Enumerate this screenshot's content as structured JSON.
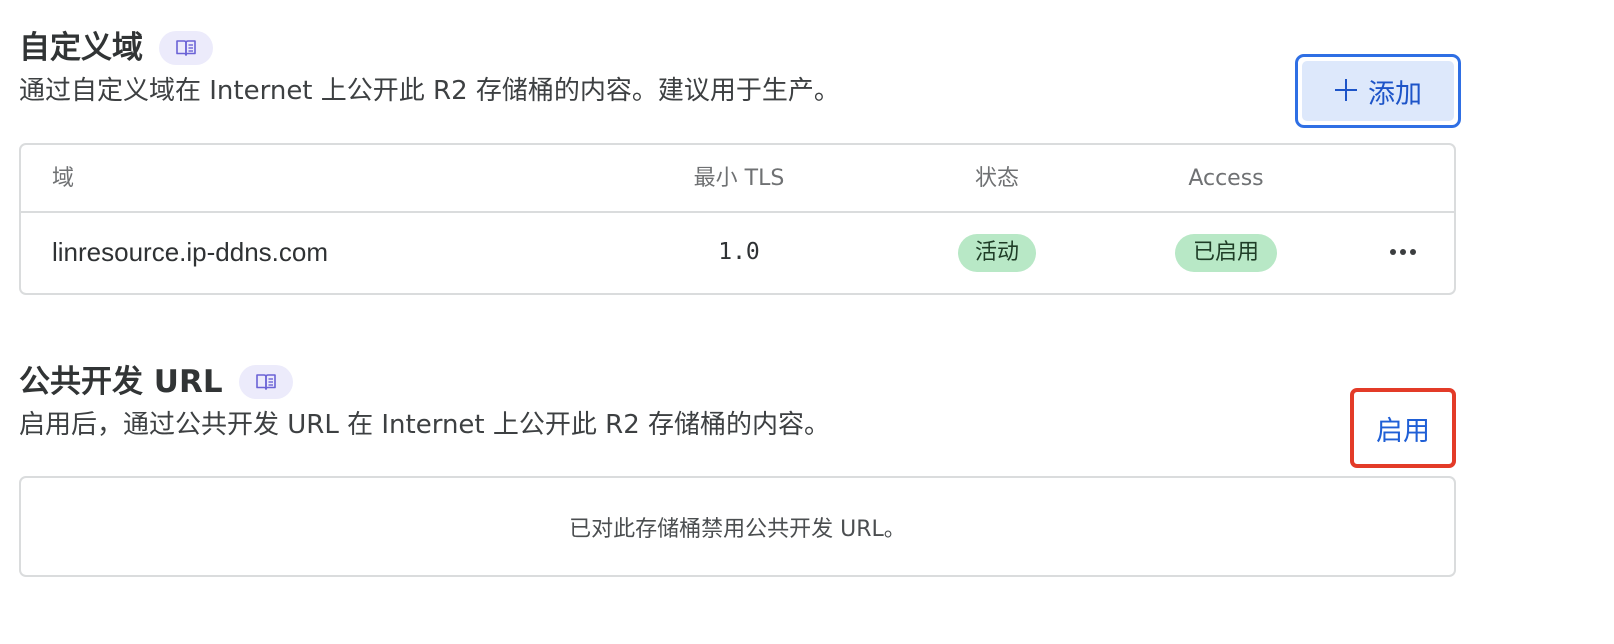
{
  "custom_domains": {
    "title": "自定义域",
    "doc_icon": "book-icon",
    "description": "通过自定义域在 Internet 上公开此 R2 存储桶的内容。建议用于生产。",
    "add_button": {
      "icon": "plus-icon",
      "label": "添加"
    },
    "table": {
      "columns": [
        "域",
        "最小 TLS",
        "状态",
        "Access"
      ],
      "rows": [
        {
          "domain": "linresource.ip-ddns.com",
          "min_tls": "1.0",
          "status": "活动",
          "access": "已启用",
          "actions_icon": "more-horizontal-icon"
        }
      ]
    }
  },
  "public_dev_url": {
    "title": "公共开发 URL",
    "doc_icon": "book-icon",
    "description": "启用后，通过公共开发 URL 在 Internet 上公开此 R2 存储桶的内容。",
    "enable_button": {
      "label": "启用"
    },
    "empty_message": "已对此存储桶禁用公共开发 URL。"
  },
  "colors": {
    "accent_blue": "#1d54c8",
    "focus_border_blue": "#2f6fe4",
    "highlight_red": "#e33b28",
    "badge_green": "#b8e8c6",
    "doc_badge_bg": "#ecebfb"
  }
}
